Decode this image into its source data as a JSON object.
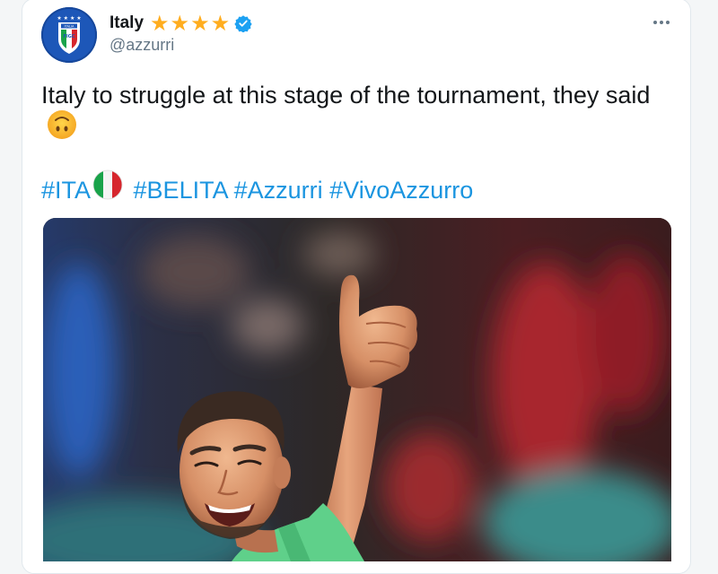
{
  "tweet": {
    "author": {
      "display_name": "Italy",
      "stars": 4,
      "verified": true,
      "handle": "@azzurri",
      "avatar": "italy-fa-crest"
    },
    "text": "Italy to struggle at this stage of the tournament, they said",
    "emoji": "upside-down-face",
    "hashtags": [
      "#ITA",
      "#BELITA",
      "#Azzurri",
      "#VivoAzzurro"
    ],
    "hashtag_flag": "italy-flag",
    "media": {
      "type": "photo",
      "subject": "goalkeeper-thumbs-up"
    }
  },
  "colors": {
    "link": "#1b95e0",
    "star": "#ffad1f",
    "verified": "#1da1f2",
    "avatar": "#1d57b8",
    "jersey": "#5fd08a"
  }
}
